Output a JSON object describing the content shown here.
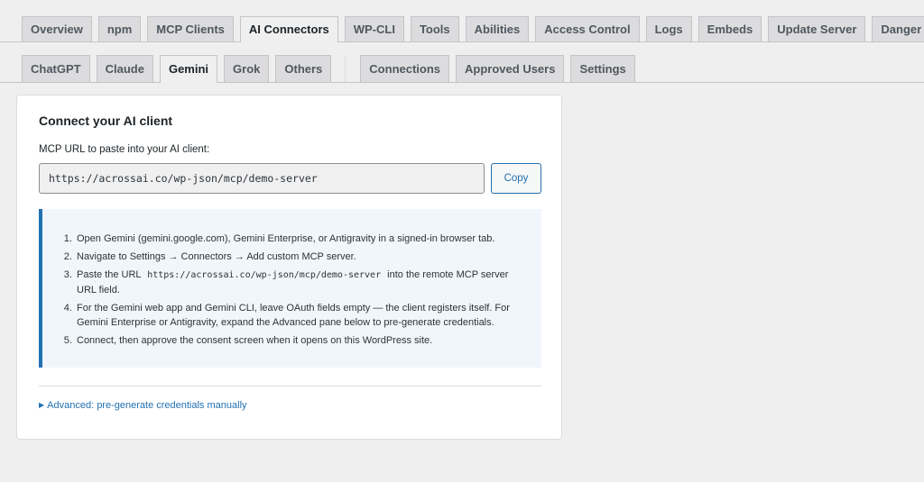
{
  "main_tabs": [
    {
      "label": "Overview"
    },
    {
      "label": "npm"
    },
    {
      "label": "MCP Clients"
    },
    {
      "label": "AI Connectors",
      "active": true
    },
    {
      "label": "WP-CLI"
    },
    {
      "label": "Tools"
    },
    {
      "label": "Abilities"
    },
    {
      "label": "Access Control"
    },
    {
      "label": "Logs"
    },
    {
      "label": "Embeds"
    },
    {
      "label": "Update Server"
    },
    {
      "label": "Danger Zone"
    }
  ],
  "sub_tabs_clients": [
    {
      "label": "ChatGPT"
    },
    {
      "label": "Claude"
    },
    {
      "label": "Gemini",
      "active": true
    },
    {
      "label": "Grok"
    },
    {
      "label": "Others"
    }
  ],
  "sub_tabs_admin": [
    {
      "label": "Connections"
    },
    {
      "label": "Approved Users"
    },
    {
      "label": "Settings"
    }
  ],
  "card": {
    "title": "Connect your AI client",
    "url_label": "MCP URL to paste into your AI client:",
    "url_value": "https://acrossai.co/wp-json/mcp/demo-server",
    "copy_label": "Copy"
  },
  "steps": {
    "s1": "Open Gemini (gemini.google.com), Gemini Enterprise, or Antigravity in a signed-in browser tab.",
    "s2": "Navigate to Settings → Connectors → Add custom MCP server.",
    "s3_pre": "Paste the URL",
    "s3_code": "https://acrossai.co/wp-json/mcp/demo-server",
    "s3_post": "into the remote MCP server URL field.",
    "s4": "For the Gemini web app and Gemini CLI, leave OAuth fields empty — the client registers itself. For Gemini Enterprise or Antigravity, expand the Advanced pane below to pre-generate credentials.",
    "s5": "Connect, then approve the consent screen when it opens on this WordPress site."
  },
  "advanced": {
    "icon": "triangle-right-icon",
    "label": "Advanced: pre-generate credentials manually"
  },
  "colors": {
    "accent": "#2271b1",
    "tab_bg": "#dcdcde",
    "page_bg": "#efefef"
  }
}
